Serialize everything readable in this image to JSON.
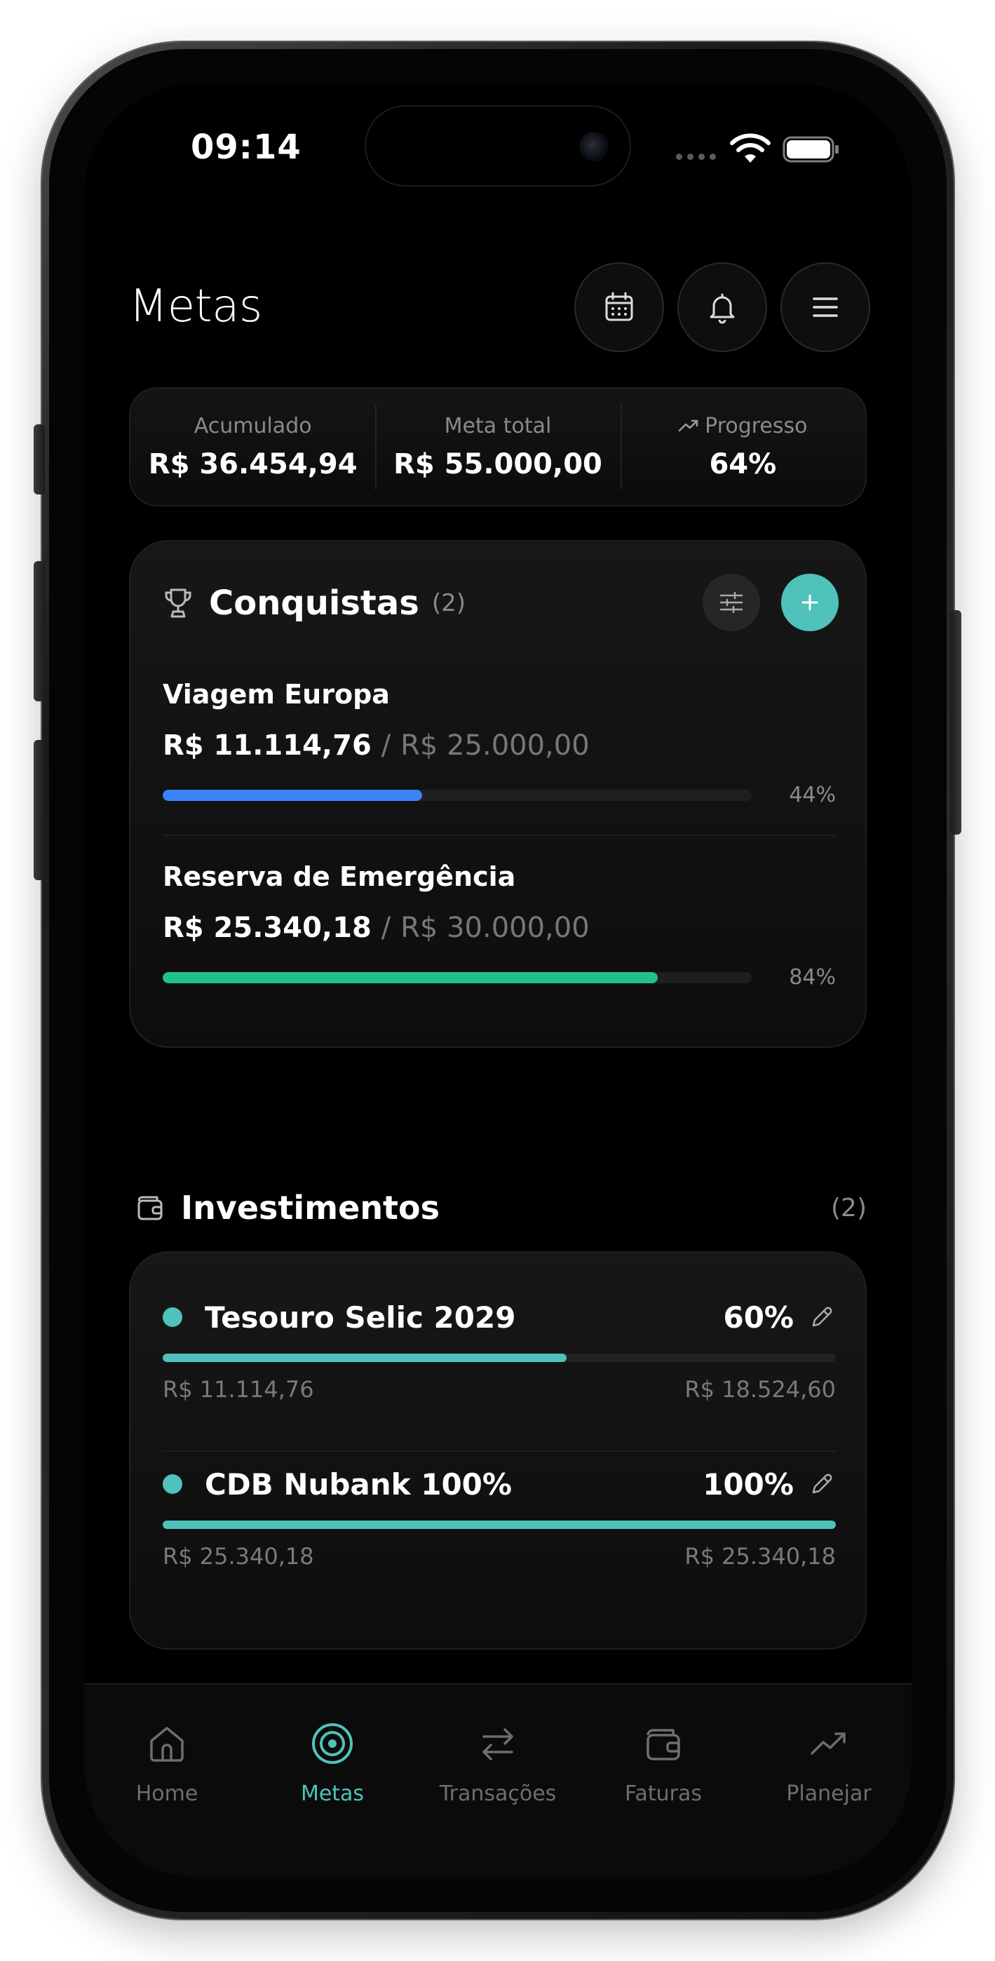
{
  "status_bar": {
    "time": "09:14"
  },
  "header": {
    "title": "Metas"
  },
  "summary": [
    {
      "label": "Acumulado",
      "value": "R$ 36.454,94"
    },
    {
      "label": "Meta total",
      "value": "R$ 55.000,00"
    },
    {
      "label": "Progresso",
      "value": "64%",
      "icon": "trending-up-icon"
    }
  ],
  "achievements": {
    "title": "Conquistas",
    "count": "(2)",
    "goals": [
      {
        "name": "Viagem Europa",
        "current": "R$ 11.114,76",
        "separator": "/",
        "target": "R$ 25.000,00",
        "percent": "44%",
        "progress": 0.44,
        "color": "#3b82f6"
      },
      {
        "name": "Reserva de Emergência",
        "current": "R$ 25.340,18",
        "separator": "/",
        "target": "R$ 30.000,00",
        "percent": "84%",
        "progress": 0.84,
        "color": "#22c08a"
      }
    ]
  },
  "investments": {
    "title": "Investimentos",
    "count": "(2)",
    "items": [
      {
        "name": "Tesouro Selic 2029",
        "percent": "60%",
        "progress": 0.6,
        "current": "R$ 11.114,76",
        "target": "R$ 18.524,60"
      },
      {
        "name": "CDB Nubank 100%",
        "percent": "100%",
        "progress": 1.0,
        "current": "R$ 25.340,18",
        "target": "R$ 25.340,18"
      }
    ]
  },
  "tabs": [
    {
      "label": "Home",
      "icon": "home-icon",
      "active": false
    },
    {
      "label": "Metas",
      "icon": "target-icon",
      "active": true
    },
    {
      "label": "Transações",
      "icon": "transfer-arrows-icon",
      "active": false
    },
    {
      "label": "Faturas",
      "icon": "wallet-icon",
      "active": false
    },
    {
      "label": "Planejar",
      "icon": "trending-up-icon",
      "active": false
    }
  ],
  "colors": {
    "accent": "#4ec2bb",
    "goal_blue": "#3b82f6",
    "goal_green": "#22c08a",
    "background": "#000000"
  }
}
